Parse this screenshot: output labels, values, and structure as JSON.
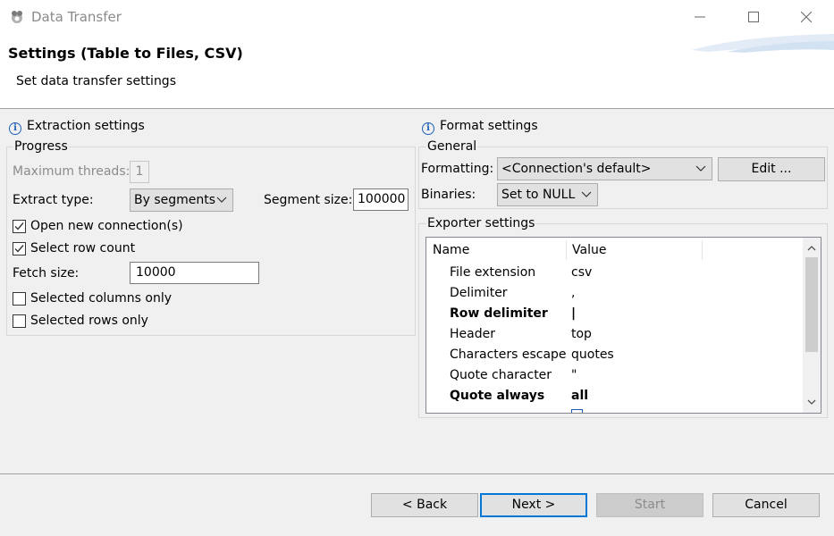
{
  "window": {
    "title": "Data Transfer",
    "icon": "dbeaver-beaver-icon"
  },
  "header": {
    "title": "Settings (Table to Files, CSV)",
    "subtitle": "Set data transfer settings"
  },
  "extraction": {
    "section_title": "Extraction settings",
    "progress_label": "Progress",
    "max_threads_label": "Maximum threads:",
    "max_threads_value": "1",
    "extract_type_label": "Extract type:",
    "extract_type_value": "By segments",
    "segment_size_label": "Segment size:",
    "segment_size_value": "100000",
    "open_new_connection": {
      "label": "Open new connection(s)",
      "checked": true
    },
    "select_row_count": {
      "label": "Select row count",
      "checked": true
    },
    "fetch_size_label": "Fetch size:",
    "fetch_size_value": "10000",
    "selected_columns_only": {
      "label": "Selected columns only",
      "checked": false
    },
    "selected_rows_only": {
      "label": "Selected rows only",
      "checked": false
    }
  },
  "format": {
    "section_title": "Format settings",
    "general_label": "General",
    "formatting_label": "Formatting:",
    "formatting_value": "<Connection's default>",
    "edit_button": "Edit ...",
    "binaries_label": "Binaries:",
    "binaries_value": "Set to NULL",
    "exporter_label": "Exporter settings",
    "table": {
      "columns": [
        "Name",
        "Value"
      ],
      "rows": [
        {
          "name": "File extension",
          "value": "csv",
          "bold": false
        },
        {
          "name": "Delimiter",
          "value": ",",
          "bold": false
        },
        {
          "name": "Row delimiter",
          "value": "|",
          "bold": true
        },
        {
          "name": "Header",
          "value": "top",
          "bold": false
        },
        {
          "name": "Characters escape",
          "value": "quotes",
          "bold": false
        },
        {
          "name": "Quote character",
          "value": "\"",
          "bold": false
        },
        {
          "name": "Quote always",
          "value": "all",
          "bold": true
        }
      ]
    }
  },
  "buttons": {
    "back": "< Back",
    "next": "Next >",
    "start": "Start",
    "cancel": "Cancel"
  },
  "colors": {
    "accent": "#0078d7",
    "info_icon": "#1c5fb8",
    "header_bg": "#ffffff",
    "dialog_bg": "#f0f0f0"
  }
}
